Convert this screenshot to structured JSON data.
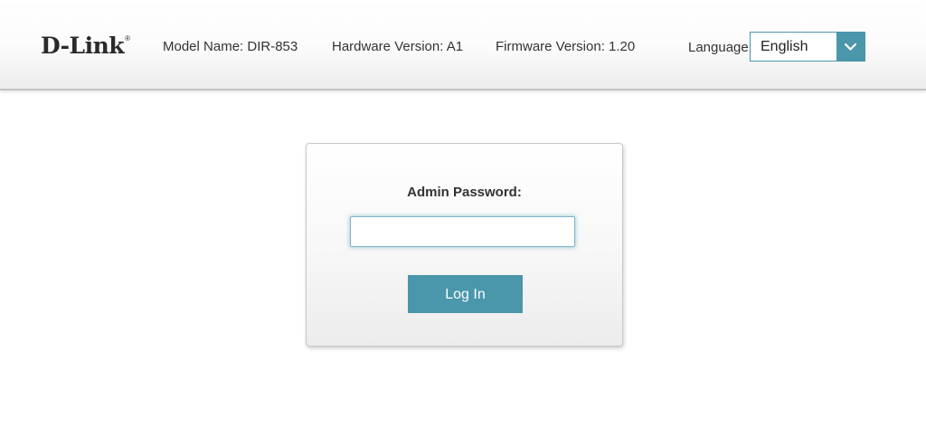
{
  "header": {
    "logo_text": "D-Link",
    "logo_mark": "®",
    "model_name": "Model Name: DIR-853",
    "hardware_version": "Hardware Version: A1",
    "firmware_version": "Firmware Version: 1.20",
    "language_label": "Language:",
    "language_value": "English",
    "language_arrow_icon": "chevron-down-icon"
  },
  "login": {
    "password_label": "Admin Password:",
    "password_value": "",
    "login_button": "Log In"
  },
  "colors": {
    "accent": "#4a96ab",
    "header_border": "#c4c4c4",
    "text": "#333333"
  }
}
